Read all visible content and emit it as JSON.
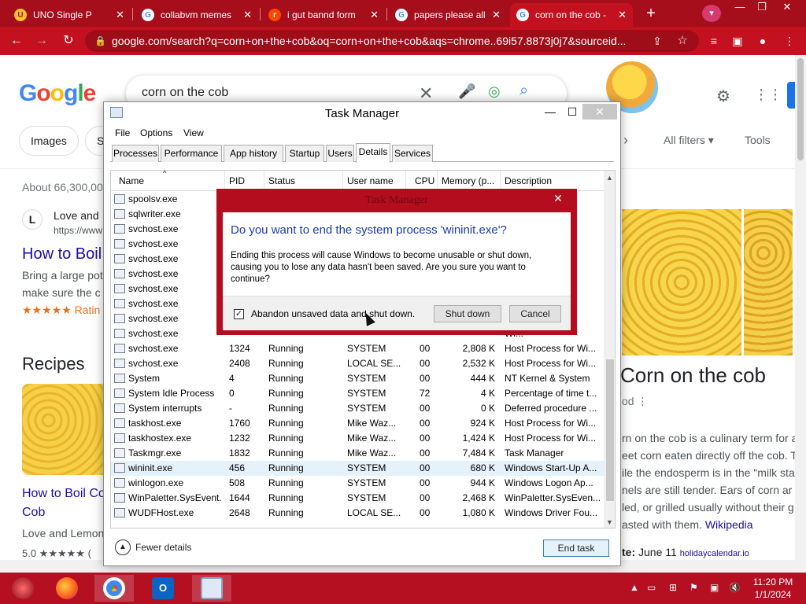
{
  "browser": {
    "tabs": [
      {
        "title": "UNO Single P",
        "active": false
      },
      {
        "title": "collabvm memes",
        "active": false
      },
      {
        "title": "i gut bannd form",
        "active": false
      },
      {
        "title": "papers please all",
        "active": false
      },
      {
        "title": "corn on the cob -",
        "active": true
      }
    ],
    "url": "google.com/search?q=corn+on+the+cob&oq=corn+on+the+cob&aqs=chrome..69i57.8873j0j7&sourceid...",
    "colors": {
      "frame": "#a50e1a",
      "toolbar": "#c4111f"
    }
  },
  "google": {
    "logo": [
      "G",
      "o",
      "o",
      "g",
      "l",
      "e"
    ],
    "query": "corn on the cob",
    "chips": [
      "Images",
      "S"
    ],
    "all_filters": "All filters",
    "tools": "Tools",
    "about": "About 66,300,00",
    "result_source": "Love and",
    "result_url": "https://www",
    "result_title": "How to Boil",
    "snippet_line1": "Bring a large pot",
    "snippet_line2": "make sure the c",
    "rating": "★★★★★ Ratin",
    "recipes_heading": "Recipes",
    "recipe_title": "How to Boil Co Cob",
    "recipe_source": "Love and Lemon",
    "recipe_rating": "5.0 ★★★★★ (",
    "kp_title": "Corn on the cob",
    "kp_sub": "od",
    "kp_desc_lines": [
      "rn on the cob is a culinary term for a",
      "eet corn eaten directly off the cob. T",
      "ile the endosperm is in the \"milk sta",
      "nels are still tender. Ears of corn ar",
      "led, or grilled usually without their g",
      "asted with them."
    ],
    "kp_wiki": "Wikipedia",
    "kp_date_label": "te:",
    "kp_date": "June 11",
    "kp_date_source": "holidaycalendar.io"
  },
  "taskmgr": {
    "title": "Task Manager",
    "menu": [
      "File",
      "Options",
      "View"
    ],
    "tabs": [
      "Processes",
      "Performance",
      "App history",
      "Startup",
      "Users",
      "Details",
      "Services"
    ],
    "active_tab": "Details",
    "columns": [
      "Name",
      "PID",
      "Status",
      "User name",
      "CPU",
      "Memory (p...",
      "Description"
    ],
    "rows": [
      {
        "name": "spoolsv.exe",
        "pid": "",
        "status": "",
        "user": "",
        "cpu": "",
        "mem": "",
        "desc": "..."
      },
      {
        "name": "sqlwriter.exe",
        "pid": "",
        "status": "",
        "user": "",
        "cpu": "",
        "mem": "",
        "desc": "rit..."
      },
      {
        "name": "svchost.exe",
        "pid": "",
        "status": "",
        "user": "",
        "cpu": "",
        "mem": "",
        "desc": "Wi..."
      },
      {
        "name": "svchost.exe",
        "pid": "",
        "status": "",
        "user": "",
        "cpu": "",
        "mem": "",
        "desc": "Wi..."
      },
      {
        "name": "svchost.exe",
        "pid": "",
        "status": "",
        "user": "",
        "cpu": "",
        "mem": "",
        "desc": "Wi..."
      },
      {
        "name": "svchost.exe",
        "pid": "",
        "status": "",
        "user": "",
        "cpu": "",
        "mem": "",
        "desc": "Wi..."
      },
      {
        "name": "svchost.exe",
        "pid": "",
        "status": "",
        "user": "",
        "cpu": "",
        "mem": "",
        "desc": "Wi..."
      },
      {
        "name": "svchost.exe",
        "pid": "",
        "status": "",
        "user": "",
        "cpu": "",
        "mem": "",
        "desc": "Wi..."
      },
      {
        "name": "svchost.exe",
        "pid": "",
        "status": "",
        "user": "",
        "cpu": "",
        "mem": "",
        "desc": "Wi..."
      },
      {
        "name": "svchost.exe",
        "pid": "",
        "status": "",
        "user": "",
        "cpu": "",
        "mem": "",
        "desc": "Wi..."
      },
      {
        "name": "svchost.exe",
        "pid": "1324",
        "status": "Running",
        "user": "SYSTEM",
        "cpu": "00",
        "mem": "2,808 K",
        "desc": "Host Process for Wi..."
      },
      {
        "name": "svchost.exe",
        "pid": "2408",
        "status": "Running",
        "user": "LOCAL SE...",
        "cpu": "00",
        "mem": "2,532 K",
        "desc": "Host Process for Wi..."
      },
      {
        "name": "System",
        "pid": "4",
        "status": "Running",
        "user": "SYSTEM",
        "cpu": "00",
        "mem": "444 K",
        "desc": "NT Kernel & System"
      },
      {
        "name": "System Idle Process",
        "pid": "0",
        "status": "Running",
        "user": "SYSTEM",
        "cpu": "72",
        "mem": "4 K",
        "desc": "Percentage of time t..."
      },
      {
        "name": "System interrupts",
        "pid": "-",
        "status": "Running",
        "user": "SYSTEM",
        "cpu": "00",
        "mem": "0 K",
        "desc": "Deferred procedure ..."
      },
      {
        "name": "taskhost.exe",
        "pid": "1760",
        "status": "Running",
        "user": "Mike Waz...",
        "cpu": "00",
        "mem": "924 K",
        "desc": "Host Process for Wi..."
      },
      {
        "name": "taskhostex.exe",
        "pid": "1232",
        "status": "Running",
        "user": "Mike Waz...",
        "cpu": "00",
        "mem": "1,424 K",
        "desc": "Host Process for Wi..."
      },
      {
        "name": "Taskmgr.exe",
        "pid": "1832",
        "status": "Running",
        "user": "Mike Waz...",
        "cpu": "00",
        "mem": "7,484 K",
        "desc": "Task Manager"
      },
      {
        "name": "wininit.exe",
        "pid": "456",
        "status": "Running",
        "user": "SYSTEM",
        "cpu": "00",
        "mem": "680 K",
        "desc": "Windows Start-Up A...",
        "selected": true
      },
      {
        "name": "winlogon.exe",
        "pid": "508",
        "status": "Running",
        "user": "SYSTEM",
        "cpu": "00",
        "mem": "944 K",
        "desc": "Windows Logon Ap..."
      },
      {
        "name": "WinPaletter.SysEvent...",
        "pid": "1644",
        "status": "Running",
        "user": "SYSTEM",
        "cpu": "00",
        "mem": "2,468 K",
        "desc": "WinPaletter.SysEven..."
      },
      {
        "name": "WUDFHost.exe",
        "pid": "2648",
        "status": "Running",
        "user": "LOCAL SE...",
        "cpu": "00",
        "mem": "1,080 K",
        "desc": "Windows Driver Fou..."
      }
    ],
    "fewer_details": "Fewer details",
    "end_task": "End task"
  },
  "dialog": {
    "title": "Task Manager",
    "question": "Do you want to end the system process 'wininit.exe'?",
    "message": "Ending this process will cause Windows to become unusable or shut down, causing you to lose any data hasn't been saved. Are you sure you want to continue?",
    "checkbox_label": "Abandon unsaved data and shut down.",
    "checkbox_checked": true,
    "shutdown_label": "Shut down",
    "cancel_label": "Cancel"
  },
  "taskbar": {
    "apps": [
      "start-button",
      "firefox",
      "chrome",
      "outlook",
      "task-manager"
    ],
    "time": "11:20 PM",
    "date": "1/1/2024"
  }
}
